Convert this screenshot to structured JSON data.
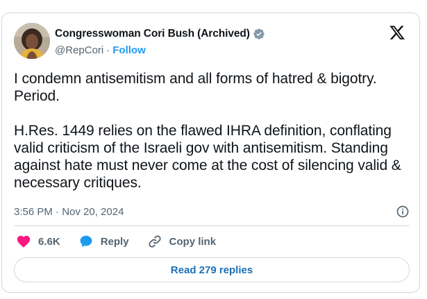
{
  "author": {
    "display_name": "Congresswoman Cori Bush (Archived)",
    "handle": "@RepCori",
    "separator": "·",
    "follow_label": "Follow",
    "verified_color": "#829aab"
  },
  "tweet": {
    "text": "I condemn antisemitism and all forms of hatred & bigotry. Period.\n\nH.Res. 1449 relies on the flawed IHRA definition, conflating valid criticism of the Israeli gov with antisemitism. Standing against hate must never come at the cost of silencing valid & necessary critiques.",
    "timestamp": "3:56 PM · Nov 20, 2024"
  },
  "actions": {
    "likes_count": "6.6K",
    "reply_label": "Reply",
    "copy_link_label": "Copy link",
    "read_replies_label": "Read 279 replies"
  },
  "icons": {
    "brand": "x-logo-icon",
    "info": "info-icon",
    "like": "heart-icon",
    "reply": "speech-bubble-icon",
    "copy": "link-icon"
  },
  "colors": {
    "accent": "#1d9bf0",
    "like": "#f91880",
    "reply_bubble": "#1d9bf0",
    "muted": "#536471"
  }
}
